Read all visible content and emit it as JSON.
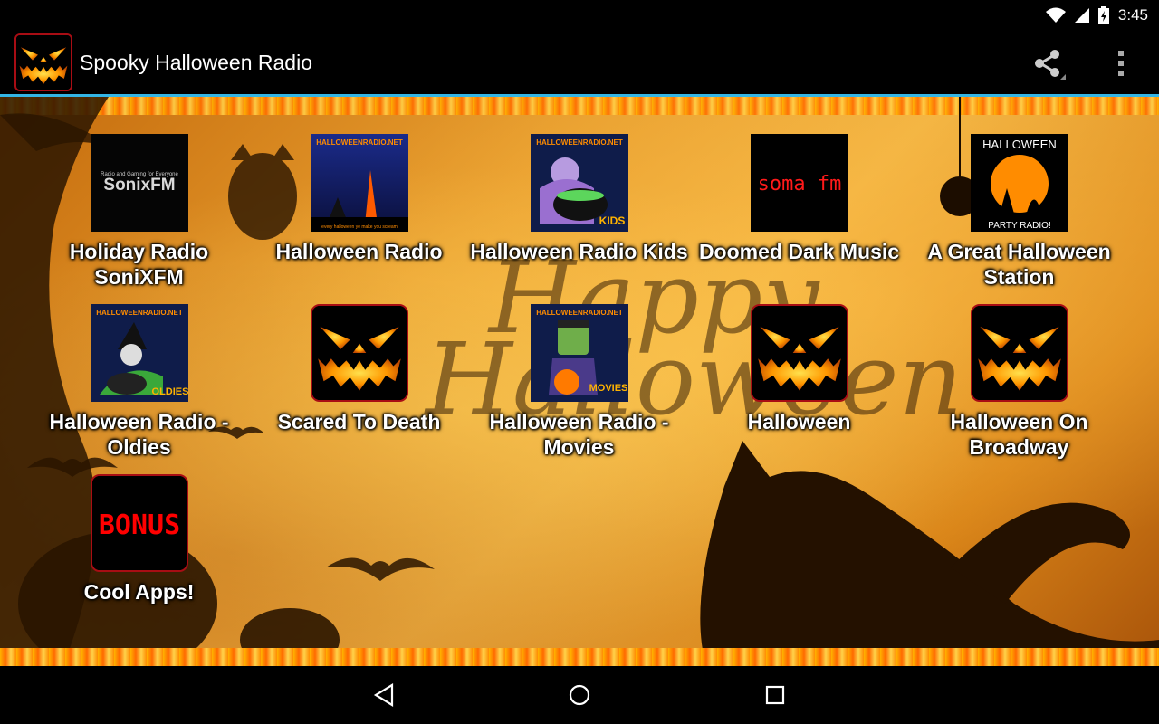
{
  "status_bar": {
    "time": "3:45"
  },
  "action_bar": {
    "title": "Spooky Halloween Radio"
  },
  "stations": [
    {
      "name": "Holiday Radio SoniXFM",
      "thumb_text": "SonixFM",
      "thumb_sub": "Radio and Gaming for Everyone"
    },
    {
      "name": "Halloween Radio",
      "thumb_text": "HALLOWEENRADIO.NET",
      "thumb_sub": "every halloween ye make you scream"
    },
    {
      "name": "Halloween Radio Kids",
      "thumb_text": "HALLOWEENRADIO.NET",
      "thumb_sub": "KIDS"
    },
    {
      "name": "Doomed Dark Music",
      "thumb_text": "soma fm"
    },
    {
      "name": "A Great Halloween Station",
      "thumb_text": "HALLOWEEN",
      "thumb_sub": "PARTY RADIO!"
    },
    {
      "name": "Halloween Radio - Oldies",
      "thumb_text": "HALLOWEENRADIO.NET",
      "thumb_sub": "OLDIES"
    },
    {
      "name": "Scared To Death"
    },
    {
      "name": "Halloween Radio - Movies",
      "thumb_text": "HALLOWEENRADIO.NET",
      "thumb_sub": "MOVIES"
    },
    {
      "name": "Halloween"
    },
    {
      "name": "Halloween On Broadway"
    },
    {
      "name": "Cool Apps!",
      "thumb_text": "BONUS"
    }
  ],
  "colors": {
    "accent": "#33b5e5",
    "tile_border": "#a80d14",
    "pumpkin": "#ffa800"
  }
}
